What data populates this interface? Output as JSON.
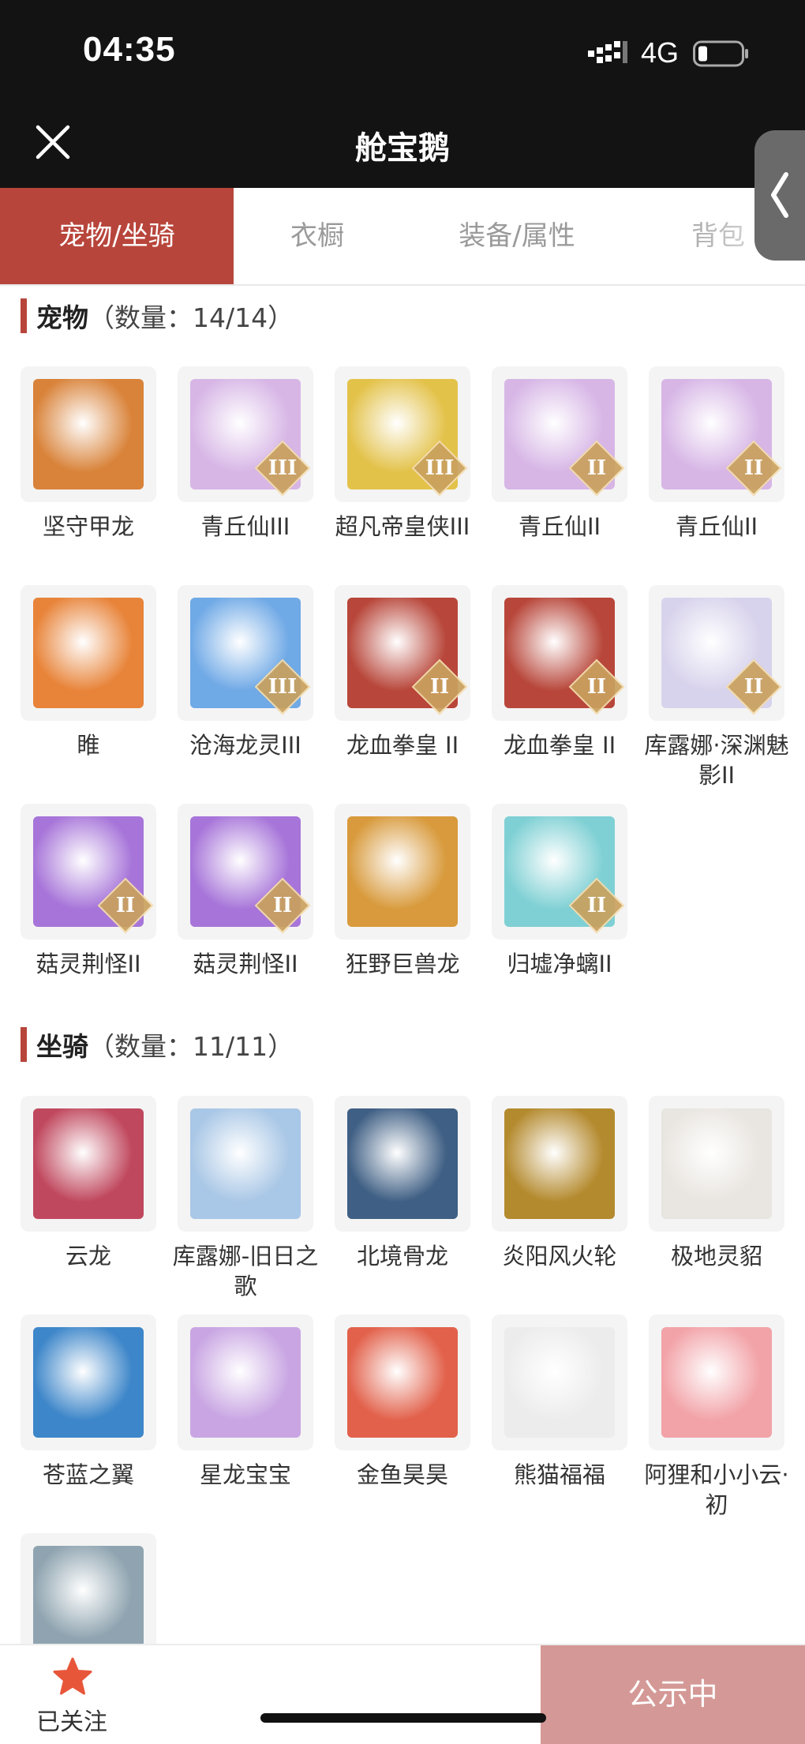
{
  "status": {
    "time": "04:35",
    "network": "4G"
  },
  "nav": {
    "title": "舱宝鹅"
  },
  "tabs": [
    {
      "label": "宠物/坐骑",
      "active": true
    },
    {
      "label": "衣橱",
      "active": false
    },
    {
      "label": "装备/属性",
      "active": false
    },
    {
      "label": "背包",
      "active": false
    }
  ],
  "pets": {
    "title": "宠物",
    "count": "（数量：14/14）",
    "items": [
      {
        "name": "坚守甲龙",
        "icon": "armored-dragon-pet",
        "color": "#d9833a",
        "tier": ""
      },
      {
        "name": "青丘仙III",
        "icon": "fox-fairy-pet",
        "color": "#d7b6e6",
        "tier": "III"
      },
      {
        "name": "超凡帝皇侠III",
        "icon": "golden-armor-pet",
        "color": "#e3c24a",
        "tier": "III"
      },
      {
        "name": "青丘仙II",
        "icon": "fox-fairy-pet",
        "color": "#d7b6e6",
        "tier": "II"
      },
      {
        "name": "青丘仙II",
        "icon": "fox-fairy-pet",
        "color": "#d7b6e6",
        "tier": "II"
      },
      {
        "name": "睢",
        "icon": "fire-bird-pet",
        "color": "#e8843a",
        "tier": ""
      },
      {
        "name": "沧海龙灵III",
        "icon": "sea-dragon-spirit-pet",
        "color": "#6fa9e6",
        "tier": "III"
      },
      {
        "name": "龙血拳皇 II",
        "icon": "red-ram-beast-pet",
        "color": "#b8463a",
        "tier": "II"
      },
      {
        "name": "龙血拳皇 II",
        "icon": "red-ram-beast-pet",
        "color": "#b8463a",
        "tier": "II"
      },
      {
        "name": "库露娜·深渊魅影II",
        "icon": "abyss-phantom-pet",
        "color": "#d8d3ec",
        "tier": "II"
      },
      {
        "name": "菇灵荆怪II",
        "icon": "mushroom-sprite-pet",
        "color": "#a775d9",
        "tier": "II"
      },
      {
        "name": "菇灵荆怪II",
        "icon": "mushroom-sprite-pet",
        "color": "#a775d9",
        "tier": "II"
      },
      {
        "name": "狂野巨兽龙",
        "icon": "wild-beast-dragon-pet",
        "color": "#d89a3c",
        "tier": ""
      },
      {
        "name": "归墟净螭II",
        "icon": "jade-dragon-pet",
        "color": "#7fd0d4",
        "tier": "II"
      }
    ]
  },
  "mounts": {
    "title": "坐骑",
    "count": "（数量：11/11）",
    "items": [
      {
        "name": "云龙",
        "icon": "cloud-dragon-mount",
        "color": "#c0485e"
      },
      {
        "name": "库露娜-旧日之歌",
        "icon": "sheep-girl-mount",
        "color": "#a9c7e6"
      },
      {
        "name": "北境骨龙",
        "icon": "bone-dragon-mount",
        "color": "#3f5f84"
      },
      {
        "name": "炎阳风火轮",
        "icon": "fire-wheel-mount",
        "color": "#b48a2e"
      },
      {
        "name": "极地灵貂",
        "icon": "arctic-mink-mount",
        "color": "#e9e5e0"
      },
      {
        "name": "苍蓝之翼",
        "icon": "azure-wing-mount",
        "color": "#3d86c9"
      },
      {
        "name": "星龙宝宝",
        "icon": "star-dragon-baby-mount",
        "color": "#c9a6e3"
      },
      {
        "name": "金鱼昊昊",
        "icon": "goldfish-mount",
        "color": "#e2614b"
      },
      {
        "name": "熊猫福福",
        "icon": "panda-mount",
        "color": "#ececec"
      },
      {
        "name": "阿狸和小小云·初",
        "icon": "fox-and-cloud-mount",
        "color": "#f2a3a8"
      },
      {
        "name": "",
        "icon": "shark-mount",
        "color": "#8fa4b0"
      }
    ]
  },
  "bottom": {
    "follow_label": "已关注",
    "public_label": "公示中"
  },
  "colors": {
    "accent": "#b8453b",
    "public_button": "#d49996",
    "star": "#e8563a"
  }
}
